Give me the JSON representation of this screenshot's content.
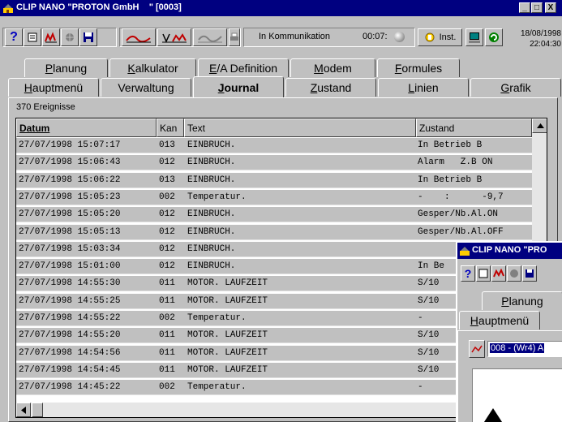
{
  "window": {
    "title": "CLIP NANO \"PROTON GmbH    \" [0003]",
    "controls": [
      "_",
      "□",
      "X"
    ]
  },
  "toolbar": {
    "help_label": "?",
    "comm_label": "In Kommunikation",
    "comm_time": "00:07:",
    "inst_label": "Inst.",
    "date": "18/08/1998",
    "time": "22:04:30"
  },
  "tabs_row1": [
    {
      "label": "Planung",
      "ul": "P",
      "rest": "lanung"
    },
    {
      "label": "Kalkulator",
      "ul": "K",
      "rest": "alkulator"
    },
    {
      "label": "E/A Definition",
      "ul": "E",
      "rest": "/A Definition"
    },
    {
      "label": "Modem",
      "ul": "M",
      "rest": "odem"
    },
    {
      "label": "Formules",
      "ul": "F",
      "rest": "ormules"
    }
  ],
  "tabs_row2": [
    {
      "label": "Hauptmenü",
      "ul": "H",
      "rest": "auptmenü"
    },
    {
      "label": "Verwaltung",
      "ul": "",
      "rest": "Verwaltung"
    },
    {
      "label": "Journal",
      "ul": "J",
      "rest": "ournal"
    },
    {
      "label": "Zustand",
      "ul": "Z",
      "rest": "ustand"
    },
    {
      "label": "Linien",
      "ul": "L",
      "rest": "inien"
    },
    {
      "label": "Grafik",
      "ul": "G",
      "rest": "rafik"
    }
  ],
  "journal": {
    "count": "370 Ereignisse",
    "columns": [
      "Datum",
      "Kan",
      "Text",
      "Zustand"
    ],
    "rows": [
      [
        "27/07/1998 15:07:17",
        "013",
        "EINBRUCH.",
        "In Betrieb B"
      ],
      [
        "27/07/1998 15:06:43",
        "012",
        "EINBRUCH.",
        "Alarm   Z.B ON"
      ],
      [
        "27/07/1998 15:06:22",
        "013",
        "EINBRUCH.",
        "In Betrieb B"
      ],
      [
        "27/07/1998 15:05:23",
        "002",
        "Temperatur.",
        "-    :      -9,7"
      ],
      [
        "27/07/1998 15:05:20",
        "012",
        "EINBRUCH.",
        "Gesper/Nb.Al.ON"
      ],
      [
        "27/07/1998 15:05:13",
        "012",
        "EINBRUCH.",
        "Gesper/Nb.Al.OFF"
      ],
      [
        "27/07/1998 15:03:34",
        "012",
        "EINBRUCH.",
        ""
      ],
      [
        "27/07/1998 15:01:00",
        "012",
        "EINBRUCH.",
        "In Be"
      ],
      [
        "27/07/1998 14:55:30",
        "011",
        "MOTOR. LAUFZEIT",
        "S/10"
      ],
      [
        "27/07/1998 14:55:25",
        "011",
        "MOTOR. LAUFZEIT",
        "S/10"
      ],
      [
        "27/07/1998 14:55:22",
        "002",
        "Temperatur.",
        "-"
      ],
      [
        "27/07/1998 14:55:20",
        "011",
        "MOTOR. LAUFZEIT",
        "S/10"
      ],
      [
        "27/07/1998 14:54:56",
        "011",
        "MOTOR. LAUFZEIT",
        "S/10"
      ],
      [
        "27/07/1998 14:54:45",
        "011",
        "MOTOR. LAUFZEIT",
        "S/10"
      ],
      [
        "27/07/1998 14:45:22",
        "002",
        "Temperatur.",
        "-"
      ]
    ]
  },
  "second_window": {
    "title": "CLIP NANO \"PRO",
    "tab1": "Planung",
    "tab2": "Hauptmenü",
    "dropdown_value": "008 - (Wr4) A"
  },
  "colors": {
    "titlebar": "#000080",
    "face": "#c0c0c0",
    "chart_red": "#c00000"
  }
}
